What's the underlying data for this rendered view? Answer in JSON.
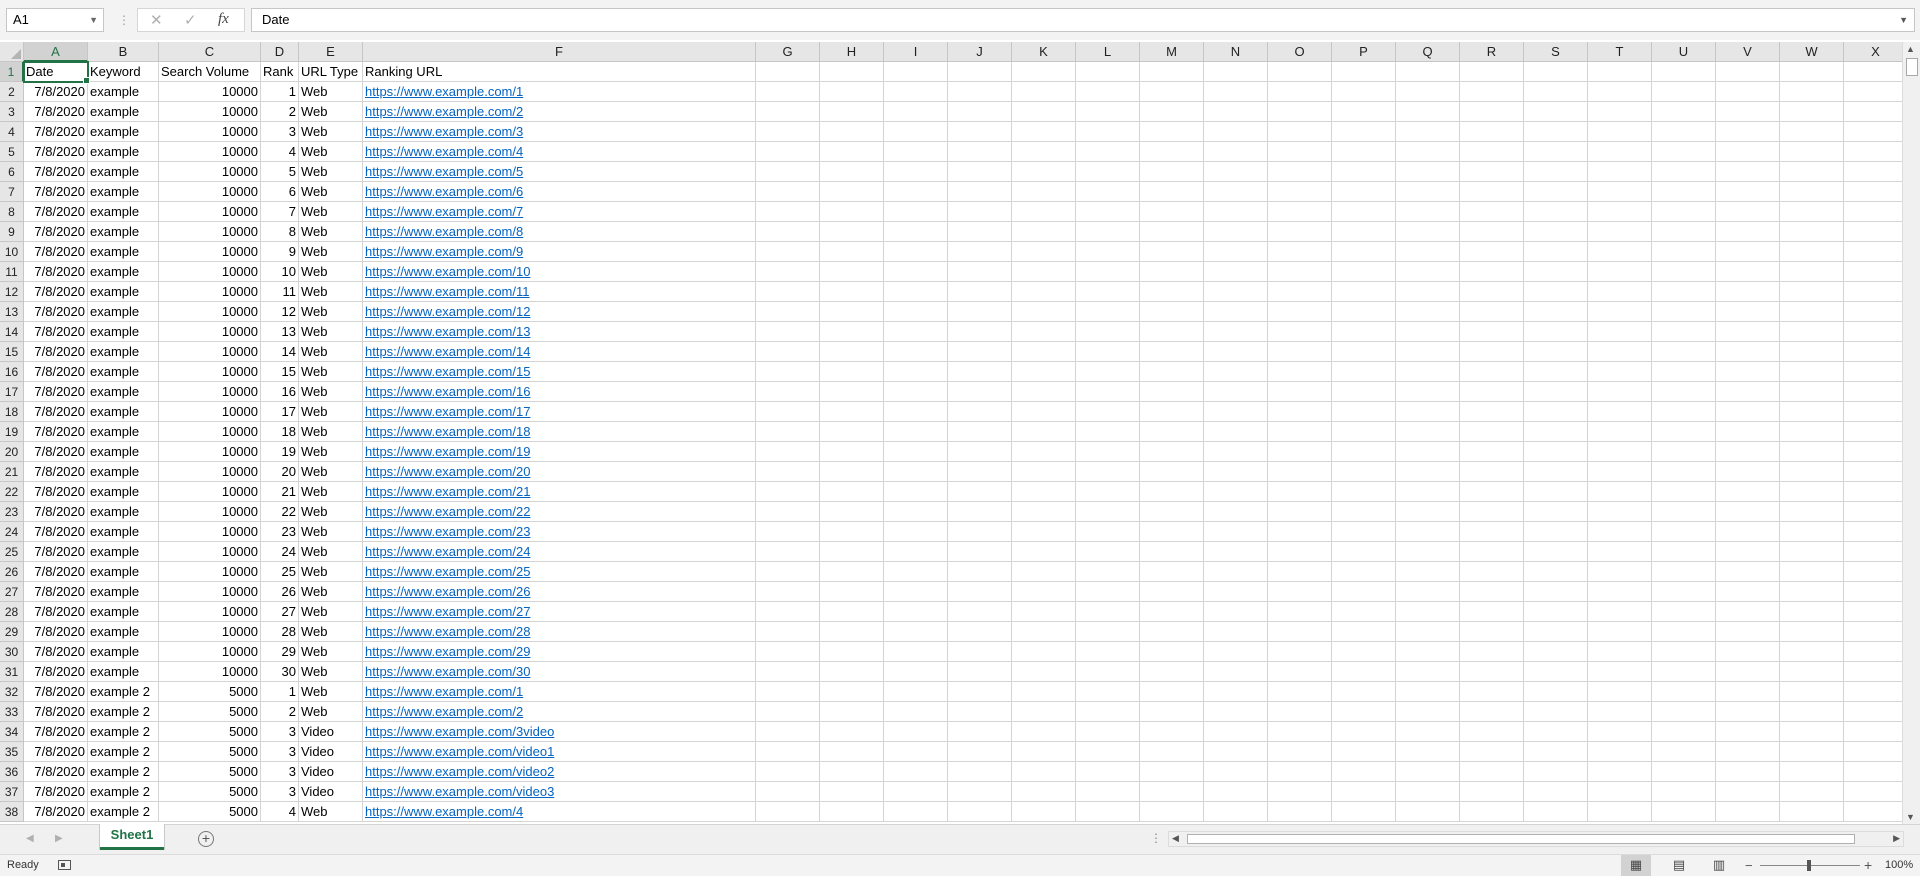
{
  "formula_bar": {
    "name_box": "A1",
    "formula": "Date"
  },
  "sheet": {
    "columns": [
      "A",
      "B",
      "C",
      "D",
      "E",
      "F",
      "G",
      "H",
      "I",
      "J",
      "K",
      "L",
      "M",
      "N",
      "O",
      "P",
      "Q",
      "R",
      "S",
      "T",
      "U",
      "V",
      "W",
      "X"
    ],
    "rows": [
      [
        "Date",
        "Keyword",
        "Search Volume",
        "Rank",
        "URL Type",
        "Ranking URL"
      ],
      [
        "7/8/2020",
        "example",
        "10000",
        "1",
        "Web",
        "https://www.example.com/1"
      ],
      [
        "7/8/2020",
        "example",
        "10000",
        "2",
        "Web",
        "https://www.example.com/2"
      ],
      [
        "7/8/2020",
        "example",
        "10000",
        "3",
        "Web",
        "https://www.example.com/3"
      ],
      [
        "7/8/2020",
        "example",
        "10000",
        "4",
        "Web",
        "https://www.example.com/4"
      ],
      [
        "7/8/2020",
        "example",
        "10000",
        "5",
        "Web",
        "https://www.example.com/5"
      ],
      [
        "7/8/2020",
        "example",
        "10000",
        "6",
        "Web",
        "https://www.example.com/6"
      ],
      [
        "7/8/2020",
        "example",
        "10000",
        "7",
        "Web",
        "https://www.example.com/7"
      ],
      [
        "7/8/2020",
        "example",
        "10000",
        "8",
        "Web",
        "https://www.example.com/8"
      ],
      [
        "7/8/2020",
        "example",
        "10000",
        "9",
        "Web",
        "https://www.example.com/9"
      ],
      [
        "7/8/2020",
        "example",
        "10000",
        "10",
        "Web",
        "https://www.example.com/10"
      ],
      [
        "7/8/2020",
        "example",
        "10000",
        "11",
        "Web",
        "https://www.example.com/11"
      ],
      [
        "7/8/2020",
        "example",
        "10000",
        "12",
        "Web",
        "https://www.example.com/12"
      ],
      [
        "7/8/2020",
        "example",
        "10000",
        "13",
        "Web",
        "https://www.example.com/13"
      ],
      [
        "7/8/2020",
        "example",
        "10000",
        "14",
        "Web",
        "https://www.example.com/14"
      ],
      [
        "7/8/2020",
        "example",
        "10000",
        "15",
        "Web",
        "https://www.example.com/15"
      ],
      [
        "7/8/2020",
        "example",
        "10000",
        "16",
        "Web",
        "https://www.example.com/16"
      ],
      [
        "7/8/2020",
        "example",
        "10000",
        "17",
        "Web",
        "https://www.example.com/17"
      ],
      [
        "7/8/2020",
        "example",
        "10000",
        "18",
        "Web",
        "https://www.example.com/18"
      ],
      [
        "7/8/2020",
        "example",
        "10000",
        "19",
        "Web",
        "https://www.example.com/19"
      ],
      [
        "7/8/2020",
        "example",
        "10000",
        "20",
        "Web",
        "https://www.example.com/20"
      ],
      [
        "7/8/2020",
        "example",
        "10000",
        "21",
        "Web",
        "https://www.example.com/21"
      ],
      [
        "7/8/2020",
        "example",
        "10000",
        "22",
        "Web",
        "https://www.example.com/22"
      ],
      [
        "7/8/2020",
        "example",
        "10000",
        "23",
        "Web",
        "https://www.example.com/23"
      ],
      [
        "7/8/2020",
        "example",
        "10000",
        "24",
        "Web",
        "https://www.example.com/24"
      ],
      [
        "7/8/2020",
        "example",
        "10000",
        "25",
        "Web",
        "https://www.example.com/25"
      ],
      [
        "7/8/2020",
        "example",
        "10000",
        "26",
        "Web",
        "https://www.example.com/26"
      ],
      [
        "7/8/2020",
        "example",
        "10000",
        "27",
        "Web",
        "https://www.example.com/27"
      ],
      [
        "7/8/2020",
        "example",
        "10000",
        "28",
        "Web",
        "https://www.example.com/28"
      ],
      [
        "7/8/2020",
        "example",
        "10000",
        "29",
        "Web",
        "https://www.example.com/29"
      ],
      [
        "7/8/2020",
        "example",
        "10000",
        "30",
        "Web",
        "https://www.example.com/30"
      ],
      [
        "7/8/2020",
        "example 2",
        "5000",
        "1",
        "Web",
        "https://www.example.com/1"
      ],
      [
        "7/8/2020",
        "example 2",
        "5000",
        "2",
        "Web",
        "https://www.example.com/2"
      ],
      [
        "7/8/2020",
        "example 2",
        "5000",
        "3",
        "Video",
        "https://www.example.com/3video"
      ],
      [
        "7/8/2020",
        "example 2",
        "5000",
        "3",
        "Video",
        "https://www.example.com/video1"
      ],
      [
        "7/8/2020",
        "example 2",
        "5000",
        "3",
        "Video",
        "https://www.example.com/video2"
      ],
      [
        "7/8/2020",
        "example 2",
        "5000",
        "3",
        "Video",
        "https://www.example.com/video3"
      ],
      [
        "7/8/2020",
        "example 2",
        "5000",
        "4",
        "Web",
        "https://www.example.com/4"
      ]
    ],
    "active_cell": "A1"
  },
  "tabs": {
    "sheets": [
      "Sheet1"
    ],
    "active": "Sheet1"
  },
  "status": {
    "text": "Ready",
    "zoom": "100%",
    "zoom_percent": 100
  },
  "colors": {
    "accent": "#217346",
    "link": "#0563c1"
  },
  "icons": {
    "cancel": "close-icon",
    "enter": "checkmark-icon",
    "function": "fx-icon",
    "add_sheet": "plus-circle-icon",
    "macro": "macro-record-icon"
  }
}
